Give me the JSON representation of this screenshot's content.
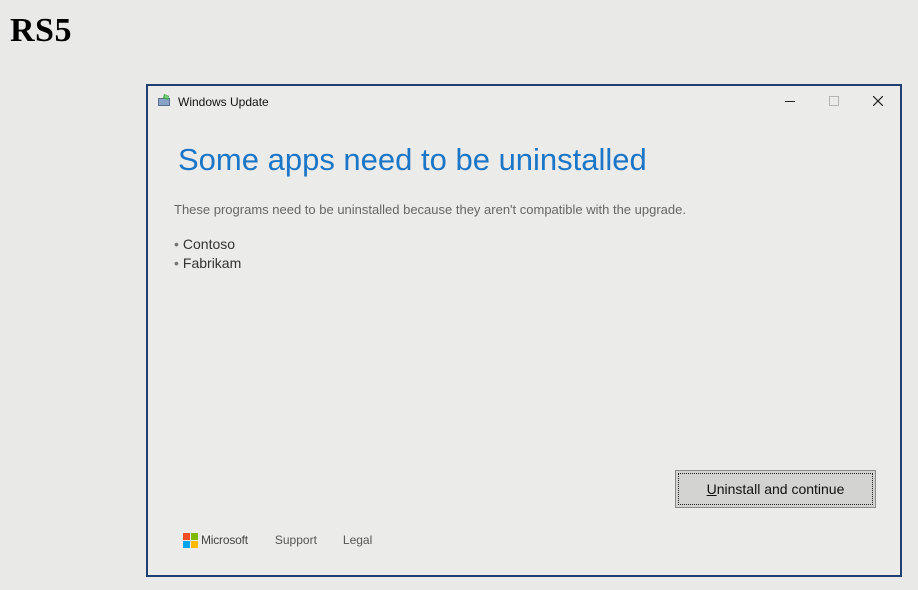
{
  "slide": {
    "label": "RS5"
  },
  "window": {
    "title": "Windows Update",
    "controls": {
      "minimize_icon": "minimize-icon",
      "maximize_icon": "maximize-icon",
      "close_icon": "close-icon"
    }
  },
  "content": {
    "heading": "Some apps need to be uninstalled",
    "description": "These programs need to be uninstalled because they aren't compatible with the upgrade.",
    "apps": [
      {
        "bullet": "•",
        "name": "Contoso"
      },
      {
        "bullet": "•",
        "name": "Fabrikam"
      }
    ]
  },
  "actions": {
    "primary_accel": "U",
    "primary_rest": "ninstall and continue"
  },
  "footer": {
    "brand": "Microsoft",
    "links": [
      "Support",
      "Legal"
    ]
  },
  "colors": {
    "accent": "#1b76c8",
    "window_border": "#1f3f73",
    "logo": [
      "#f25022",
      "#7fba00",
      "#00a4ef",
      "#ffb900"
    ]
  }
}
